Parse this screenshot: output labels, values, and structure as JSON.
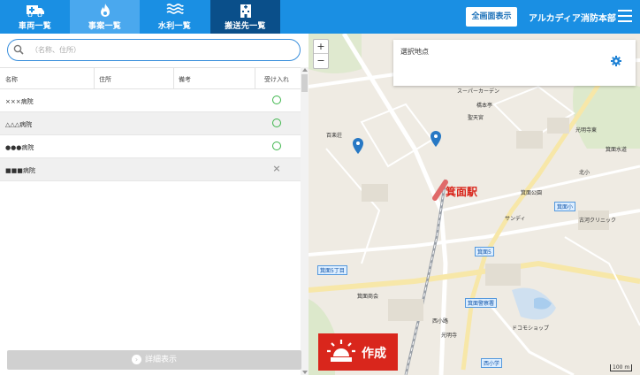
{
  "header": {
    "tabs": [
      {
        "label": "車両一覧",
        "icon": "ambulance-icon"
      },
      {
        "label": "事案一覧",
        "icon": "flame-icon"
      },
      {
        "label": "水利一覧",
        "icon": "water-icon"
      },
      {
        "label": "搬送先一覧",
        "icon": "hospital-building-icon"
      }
    ],
    "active_tab": "搬送先一覧",
    "fullscreen_label": "全画面表示",
    "org_name": "アルカディア消防本部",
    "colors": {
      "bar": "#1a8fe3",
      "active": "#0a4f8a",
      "hover": "#4aa8ee"
    }
  },
  "search": {
    "placeholder": "（名称、住所）",
    "value": ""
  },
  "table": {
    "columns": [
      "名称",
      "住所",
      "備考",
      "受け入れ"
    ],
    "rows": [
      {
        "name": "×××病院",
        "address": "",
        "note": "",
        "accept": "○"
      },
      {
        "name": "△△△病院",
        "address": "",
        "note": "",
        "accept": "○"
      },
      {
        "name": "●●●病院",
        "address": "",
        "note": "",
        "accept": "○"
      },
      {
        "name": "■■■病院",
        "address": "",
        "note": "",
        "accept": "×"
      }
    ]
  },
  "detail_button": "詳細表示",
  "map": {
    "zoom_in": "+",
    "zoom_out": "−",
    "info_title": "選択地点",
    "create_button": "作成",
    "station_label": "箕面駅",
    "labels": {
      "l1": "スーパーカーデン",
      "l2": "橋本亭",
      "l3": "聖天宮",
      "l4": "箕面警察署",
      "l5": "箕面小",
      "l6": "箕面公園",
      "l7": "箕面5",
      "l8": "西小学",
      "l9": "光明寺",
      "l10": "ドコモショップ",
      "l11": "箕面商会",
      "l12": "サンディ",
      "l13": "百楽荘",
      "l14": "光明寺東",
      "l15": "西小路",
      "l16": "箕面水道",
      "l17": "北小",
      "l18": "古河クリニック",
      "l19": "箕面5丁目"
    },
    "scale": "100 m"
  }
}
